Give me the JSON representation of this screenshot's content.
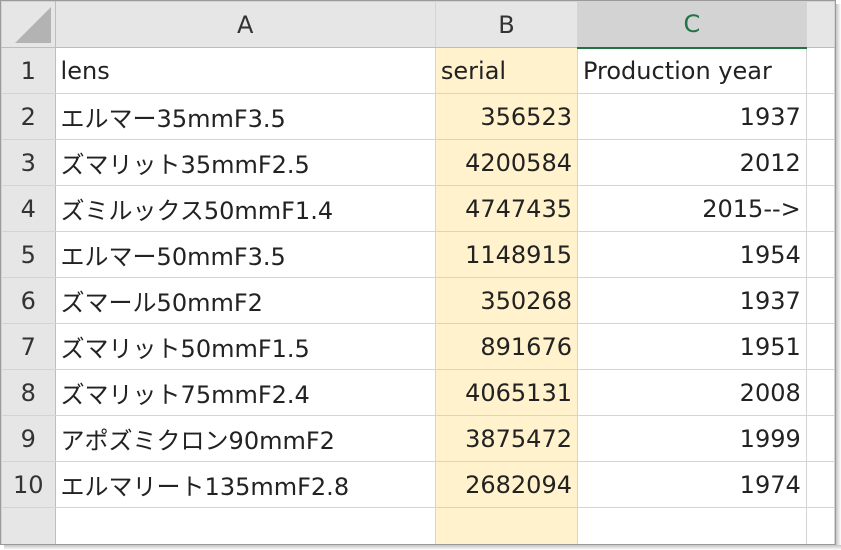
{
  "columns": [
    "A",
    "B",
    "C"
  ],
  "selected_column": "C",
  "colors": {
    "header_bg": "#e6e6e6",
    "selected_header_text": "#217346",
    "highlight_fill": "#fff2cc"
  },
  "rows": [
    {
      "num": "1",
      "a": "lens",
      "b": "serial",
      "c": "Production year"
    },
    {
      "num": "2",
      "a": "エルマー35mmF3.5",
      "b": "356523",
      "c": "1937"
    },
    {
      "num": "3",
      "a": "ズマリット35mmF2.5",
      "b": "4200584",
      "c": "2012"
    },
    {
      "num": "4",
      "a": "ズミルックス50mmF1.4",
      "b": "4747435",
      "c": "2015-->"
    },
    {
      "num": "5",
      "a": "エルマー50mmF3.5",
      "b": "1148915",
      "c": "1954"
    },
    {
      "num": "6",
      "a": "ズマール50mmF2",
      "b": "350268",
      "c": "1937"
    },
    {
      "num": "7",
      "a": "ズマリット50mmF1.5",
      "b": "891676",
      "c": "1951"
    },
    {
      "num": "8",
      "a": "ズマリット75mmF2.4",
      "b": "4065131",
      "c": "2008"
    },
    {
      "num": "9",
      "a": "アポズミクロン90mmF2",
      "b": "3875472",
      "c": "1999"
    },
    {
      "num": "10",
      "a": "エルマリート135mmF2.8",
      "b": "2682094",
      "c": "1974"
    }
  ]
}
